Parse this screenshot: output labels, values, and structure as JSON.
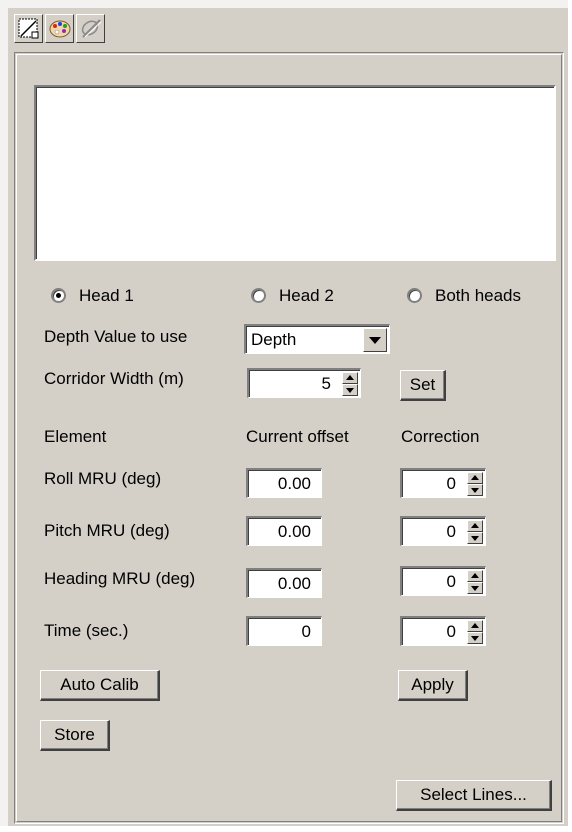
{
  "toolbar": {
    "icons": [
      "edit-area-icon",
      "palette-icon",
      "disabled-tool-icon"
    ]
  },
  "heads": {
    "head1": "Head 1",
    "head2": "Head 2",
    "both": "Both heads",
    "selected": "Head 1"
  },
  "depth": {
    "label": "Depth Value to use",
    "value": "Depth"
  },
  "corridor": {
    "label": "Corridor Width (m)",
    "value": "5",
    "set_label": "Set"
  },
  "table": {
    "headers": [
      "Element",
      "Current offset",
      "Correction"
    ],
    "rows": [
      {
        "label": "Roll MRU (deg)",
        "offset": "0.00",
        "correction": "0"
      },
      {
        "label": "Pitch MRU (deg)",
        "offset": "0.00",
        "correction": "0"
      },
      {
        "label": "Heading MRU (deg)",
        "offset": "0.00",
        "correction": "0"
      },
      {
        "label": "Time (sec.)",
        "offset": "0",
        "correction": "0"
      }
    ]
  },
  "buttons": {
    "auto_calib": "Auto Calib",
    "apply": "Apply",
    "store": "Store",
    "select_lines": "Select Lines..."
  },
  "colors": {
    "face": "#d4d0c8",
    "highlight": "#ffffff",
    "shadow": "#808080"
  }
}
